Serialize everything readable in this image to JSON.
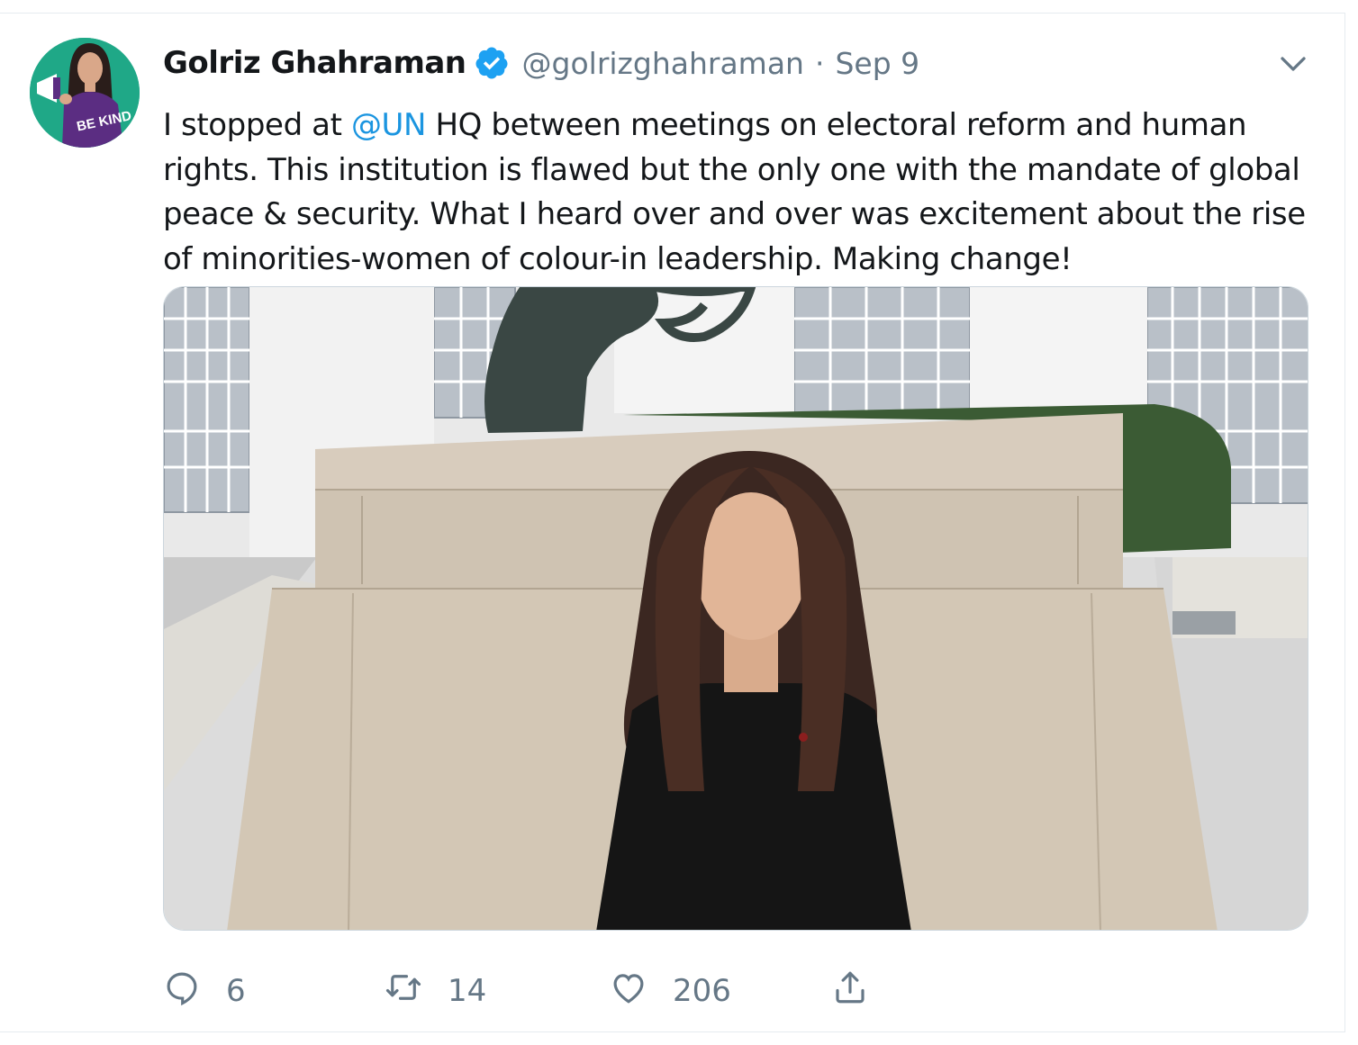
{
  "tweet": {
    "author_name": "Golriz Ghahraman",
    "handle": "@golrizghahraman",
    "separator": "·",
    "date": "Sep 9",
    "avatar_text": "BE KIND",
    "text_before_mention": "I stopped at ",
    "mention": "@UN",
    "text_after_mention": " HQ between meetings on electoral reform and human rights. This institution is flawed but the only one with the mandate of global peace & security. What I heard over and over was excitement about the rise of minorities-women of colour-in leadership. Making change!",
    "media": {
      "description_icon": "photo-woman-at-knotted-gun-sculpture"
    }
  },
  "actions": {
    "reply_count": "6",
    "retweet_count": "14",
    "like_count": "206"
  },
  "colors": {
    "link": "#1b95e0",
    "secondary_text": "#657786",
    "verified": "#1da1f2",
    "avatar_bg": "#1fa887"
  },
  "icons": [
    "verified-badge-icon",
    "chevron-down-icon",
    "reply-icon",
    "retweet-icon",
    "like-icon",
    "share-icon"
  ]
}
